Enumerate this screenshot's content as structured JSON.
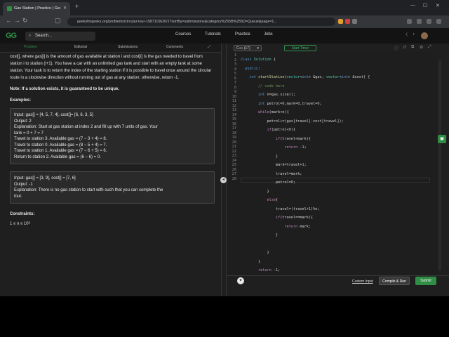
{
  "browser": {
    "tab_title": "Gas Station | Practice | GeeksforGee",
    "new_tab": "+",
    "url": "geeksforgeeks.org/problems/circular-tour-1587115620/1?sortBy=submissions&category%255B%255D=Queue&page=1..."
  },
  "header": {
    "logo": "GG",
    "search_placeholder": "Search...",
    "nav": [
      "Courses",
      "Tutorials",
      "Practice",
      "Jobs"
    ]
  },
  "left_tabs": [
    "Problem",
    "Editorial",
    "Submissions",
    "Comments"
  ],
  "problem": {
    "intro": "cost[], where gas[i] is the amount of gas available at station i and cost[i] is the gas needed to travel from station i to station (i+1). You have a car with an unlimited gas tank and start with an empty tank at some station. Your task is to return the index of the starting station if it is possible to travel once around the circular route in a clockwise direction without running out of gas at any station; otherwise, return -1.",
    "note": "Note: If a solution exists, it is guaranteed to be unique.",
    "examples_title": "Examples:",
    "example1": [
      "Input: gas[] = [4, 5, 7, 4], cost[]= [6, 6, 3, 5]",
      "Output: 2",
      "Explanation: Start at gas station at index 2 and fill up with 7 units of gas. Your",
      "tank = 0 + 7 = 7",
      "Travel to station 3. Available gas = (7 − 3 + 4) = 8.",
      "Travel to station 0. Available gas = (8 − 5 + 4) = 7.",
      "Travel to station 1. Available gas = (7 − 6 + 5) = 6.",
      "Return to station 2. Available gas = (6 − 6) = 0."
    ],
    "example2": [
      "Input: gas[] = [3, 9], cost[] = [7, 6]",
      "Output: -1",
      "Explanation: There is no gas station to start with such that you can complete the",
      "tour."
    ],
    "constraints_title": "Constraints:",
    "constraint1": "1 ≤ n ≤ 10⁶"
  },
  "editor": {
    "language": "C++ (17)",
    "timer": "Start Timer",
    "line_numbers": [
      "1",
      "2",
      "3",
      "4",
      "5",
      "6",
      "7",
      "8",
      "9",
      "10",
      "11",
      "12",
      "13",
      "14",
      "15",
      "16",
      "17",
      "18",
      "19",
      "20",
      "21",
      "22",
      "23",
      "24",
      "25",
      "26",
      "27",
      "28"
    ],
    "custom_input": "Custom Input",
    "compile_run": "Compile & Run",
    "submit": "Submit"
  }
}
